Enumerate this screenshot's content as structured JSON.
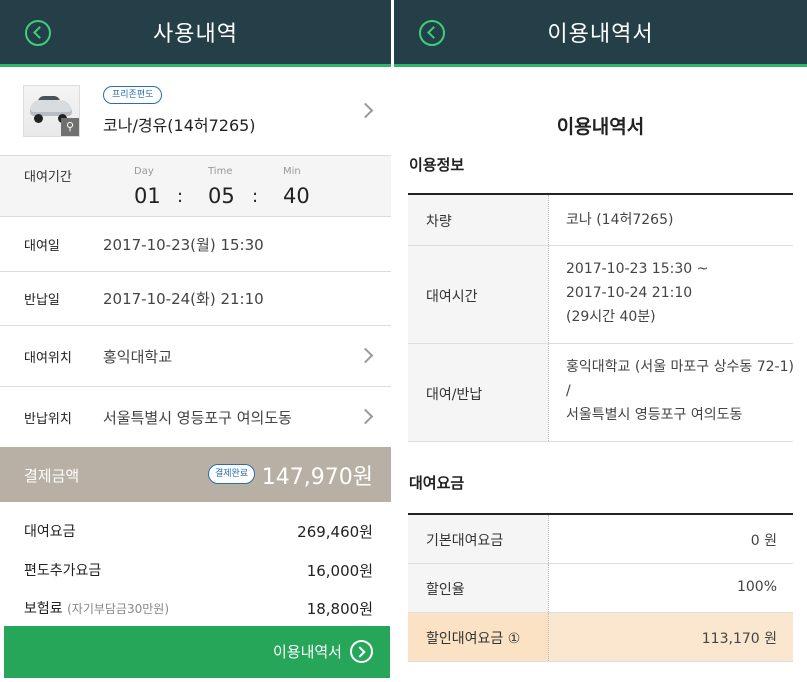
{
  "left": {
    "header_title": "사용내역",
    "car": {
      "tag": "프리존편도",
      "name": "코나/경유(14허7265)"
    },
    "period": {
      "label": "대여기간",
      "day_unit": "Day",
      "time_unit": "Time",
      "min_unit": "Min",
      "day": "01",
      "time": "05",
      "min": "40",
      "sep": ":"
    },
    "rows": [
      {
        "label": "대여일",
        "value": "2017-10-23(월) 15:30"
      },
      {
        "label": "반납일",
        "value": "2017-10-24(화) 21:10"
      },
      {
        "label": "대여위치",
        "value": "홍익대학교"
      },
      {
        "label": "반납위치",
        "value": "서울특별시 영등포구 여의도동"
      }
    ],
    "payment": {
      "label": "결제금액",
      "badge": "결제완료",
      "amount": "147,970원"
    },
    "fees": [
      {
        "label": "대여요금",
        "note": "",
        "value": "269,460원"
      },
      {
        "label": "편도추가요금",
        "note": "",
        "value": "16,000원"
      },
      {
        "label": "보험료",
        "note": "(자기부담금30만원)",
        "value": "18,800원"
      }
    ],
    "bottom_button": "이용내역서"
  },
  "right": {
    "header_title": "이용내역서",
    "doc_title": "이용내역서",
    "section1": "이용정보",
    "info": {
      "car_label": "차량",
      "car_value": "코나 (14허7265)",
      "time_label": "대여시간",
      "time_line1": "2017-10-23 15:30 ~",
      "time_line2": "2017-10-24 21:10",
      "time_line3": "(29시간 40분)",
      "loc_label": "대여/반납",
      "loc_line1": "홍익대학교 (서울 마포구 상수동 72-1)",
      "loc_line2": "/",
      "loc_line3": "서울특별시 영등포구 여의도동"
    },
    "section2": "대여요금",
    "fees": [
      {
        "label": "기본대여요금",
        "value": "0 원"
      },
      {
        "label": "할인율",
        "value": "100%"
      },
      {
        "label": "할인대여요금 ①",
        "value": "113,170 원"
      }
    ]
  },
  "colors": {
    "header": "#243f47",
    "accent_green": "#26a659",
    "payment_bar": "#b8b0a4",
    "highlight_row": "#fbe7cf"
  }
}
